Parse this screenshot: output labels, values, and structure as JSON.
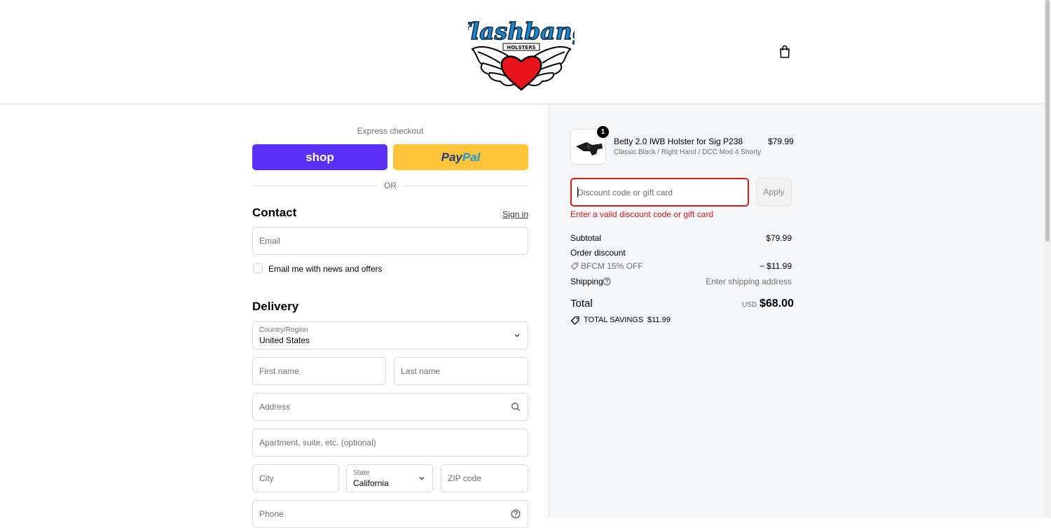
{
  "header": {
    "logo": {
      "text": "Flashbang",
      "subtext": "HOLSTERS"
    },
    "cart_icon": "shopping-bag-icon"
  },
  "express": {
    "title": "Express checkout",
    "shop_label": "shop",
    "paypal_label_1": "Pay",
    "paypal_label_2": "Pal",
    "or_label": "OR"
  },
  "contact": {
    "title": "Contact",
    "signin_label": "Sign in",
    "email_placeholder": "Email",
    "newsletter_label": "Email me with news and offers"
  },
  "delivery": {
    "title": "Delivery",
    "country_label": "Country/Region",
    "country_value": "United States",
    "first_name_placeholder": "First name",
    "last_name_placeholder": "Last name",
    "address_placeholder": "Address",
    "apartment_placeholder": "Apartment, suite, etc. (optional)",
    "city_placeholder": "City",
    "state_label": "State",
    "state_value": "California",
    "zip_placeholder": "ZIP code",
    "phone_placeholder": "Phone"
  },
  "order": {
    "product": {
      "name": "Betty 2.0 IWB Holster for Sig P238",
      "variant": "Classic Black / Right Hand / DCC Mod 4 Shorty",
      "price": "$79.99",
      "quantity": "1"
    },
    "discount": {
      "placeholder": "Discount code or gift card",
      "apply_label": "Apply",
      "error": "Enter a valid discount code or gift card"
    },
    "subtotal_label": "Subtotal",
    "subtotal_value": "$79.99",
    "order_discount_label": "Order discount",
    "discount_code": "BFCM 15% OFF",
    "discount_value": "− $11.99",
    "shipping_label": "Shipping",
    "shipping_value": "Enter shipping address",
    "total_label": "Total",
    "currency": "USD",
    "total_value": "$68.00",
    "savings_label": "TOTAL SAVINGS",
    "savings_value": "$11.99"
  },
  "colors": {
    "shop_purple": "#5a31f4",
    "paypal_yellow": "#ffc439",
    "error_red": "#d21b1b",
    "panel_bg": "#f5f6f8"
  }
}
